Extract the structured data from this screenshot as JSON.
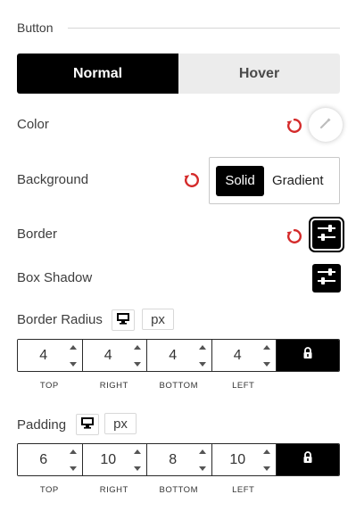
{
  "section": {
    "title": "Button"
  },
  "tabs": [
    {
      "label": "Normal",
      "active": true
    },
    {
      "label": "Hover",
      "active": false
    }
  ],
  "color": {
    "label": "Color"
  },
  "background": {
    "label": "Background",
    "options": [
      "Solid",
      "Gradient"
    ],
    "selected": "Solid"
  },
  "border": {
    "label": "Border"
  },
  "box_shadow": {
    "label": "Box Shadow"
  },
  "border_radius": {
    "label": "Border Radius",
    "unit": "px",
    "values": [
      {
        "side": "TOP",
        "value": "4"
      },
      {
        "side": "RIGHT",
        "value": "4"
      },
      {
        "side": "BOTTOM",
        "value": "4"
      },
      {
        "side": "LEFT",
        "value": "4"
      }
    ],
    "linked": true
  },
  "padding": {
    "label": "Padding",
    "unit": "px",
    "values": [
      {
        "side": "TOP",
        "value": "6"
      },
      {
        "side": "RIGHT",
        "value": "10"
      },
      {
        "side": "BOTTOM",
        "value": "8"
      },
      {
        "side": "LEFT",
        "value": "10"
      }
    ],
    "linked": true
  },
  "icons": {
    "reset": "reset-icon",
    "eyedropper": "eyedropper-icon",
    "sliders": "sliders-icon",
    "desktop": "desktop-icon",
    "lock": "lock-icon"
  },
  "colors": {
    "accent": "#000000",
    "reset": "#d42a2a",
    "inactive_tab": "#ececec"
  }
}
